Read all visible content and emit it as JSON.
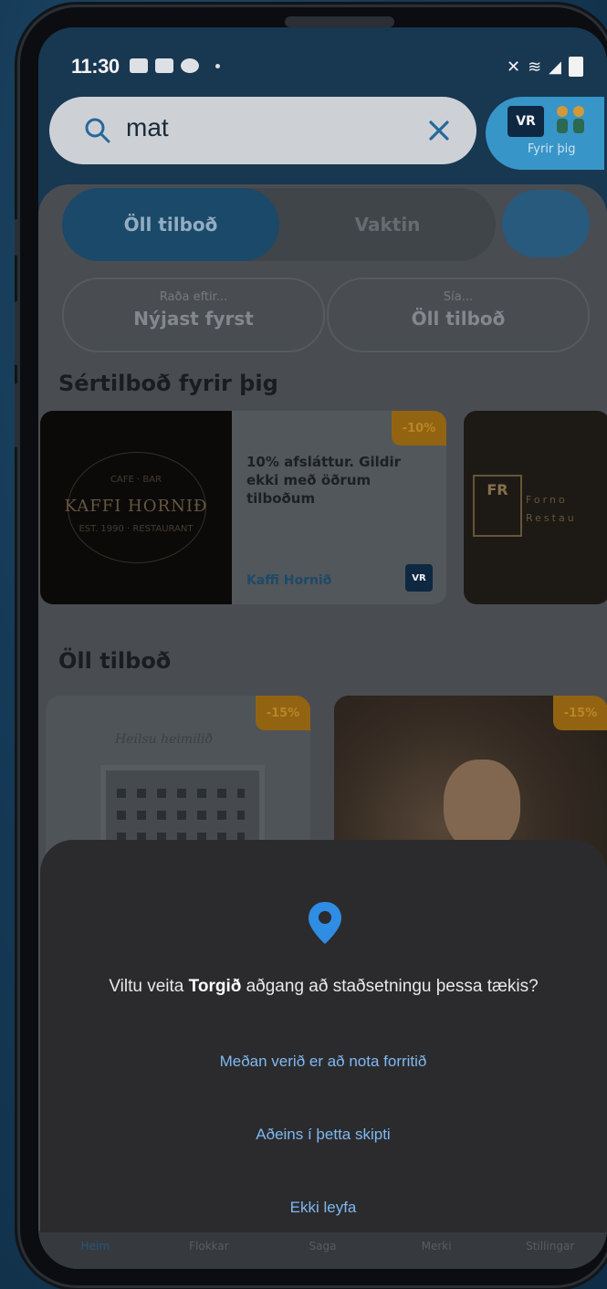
{
  "status_bar": {
    "time": "11:30"
  },
  "search": {
    "value": "mat"
  },
  "fyrir_button": {
    "logo": "VR",
    "label": "Fyrir þig"
  },
  "segments": {
    "active": "Öll tilboð",
    "inactive": "Vaktin"
  },
  "filters": {
    "sort": {
      "sub": "Raða eftir...",
      "value": "Nýjast fyrst"
    },
    "show": {
      "sub": "Sía...",
      "value": "Öll tilboð"
    }
  },
  "special_section": {
    "title": "Sértilboð fyrir þig",
    "cards": [
      {
        "badge": "-10%",
        "image_text": "KAFFI HORNIÐ",
        "image_sub_top": "CAFE · BAR",
        "image_sub_bottom": "EST. 1990 · RESTAURANT",
        "description": "10% afsláttur. Gildir ekki með öðrum tilboðum",
        "merchant": "Kaffi Hornið",
        "provider": "VR"
      },
      {
        "logo": "FR",
        "image_text": "Forno Restau"
      }
    ]
  },
  "all_section": {
    "title": "Öll tilboð",
    "cards": [
      {
        "badge": "-15%",
        "title_script": "Heilsu heimilið"
      },
      {
        "badge": "-15%"
      }
    ]
  },
  "tabbar": {
    "items": [
      "Heim",
      "Flokkar",
      "Saga",
      "Merki",
      "Stillingar"
    ],
    "active_index": 0
  },
  "dialog": {
    "question_prefix": "Viltu veita ",
    "app_name": "Torgið",
    "question_suffix": " aðgang að staðsetningu þessa tækis?",
    "buttons": {
      "while_using": "Meðan verið er að nota forritið",
      "only_this_time": "Aðeins í þetta skipti",
      "deny": "Ekki leyfa"
    },
    "accent_color": "#2f8de4"
  }
}
